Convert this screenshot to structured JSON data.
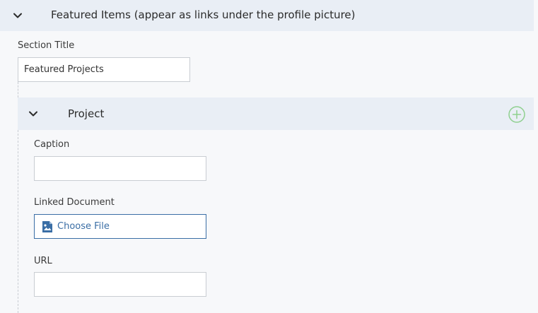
{
  "featured_section": {
    "title": "Featured Items (appear as links under the profile picture)",
    "toggle_icon": "chevron-down-icon",
    "section_title_label": "Section Title",
    "section_title_value": "Featured Projects"
  },
  "project": {
    "title": "Project",
    "toggle_icon": "chevron-down-icon",
    "add_icon": "plus-circle-icon",
    "caption_label": "Caption",
    "caption_value": "",
    "linked_document_label": "Linked Document",
    "choose_file_label": "Choose File",
    "file_icon": "image-file-icon",
    "url_label": "URL",
    "url_value": ""
  },
  "colors": {
    "header_bg": "#e9eef5",
    "accent": "#3a6ea5",
    "add_icon": "#8fd08f"
  }
}
